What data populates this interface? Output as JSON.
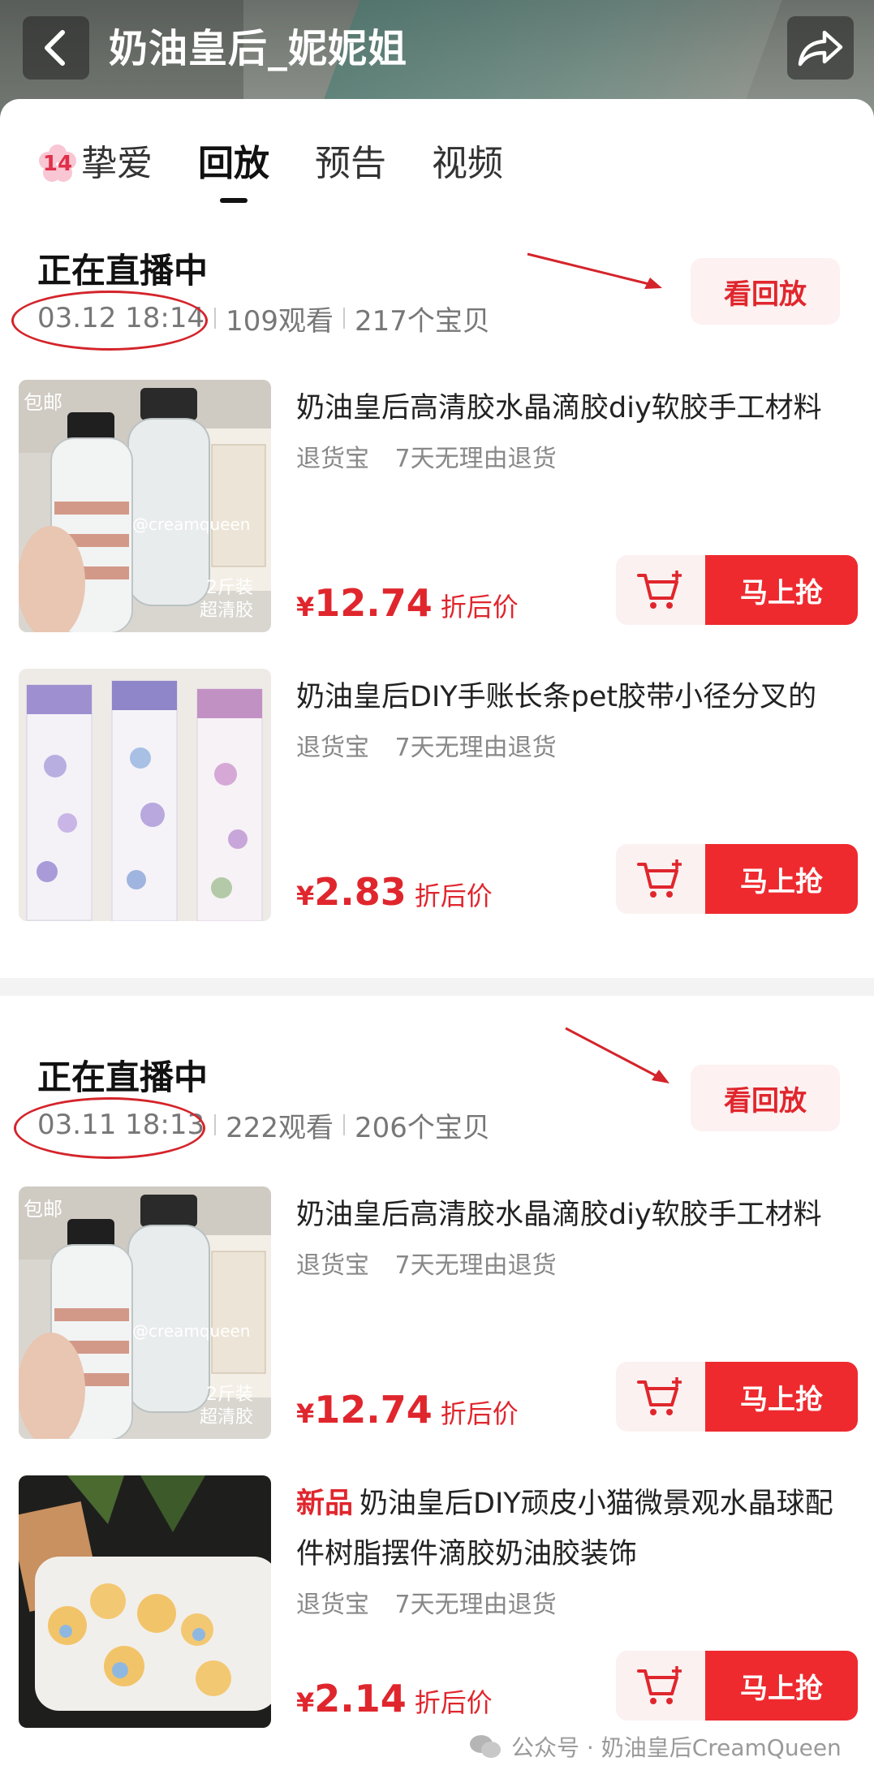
{
  "header": {
    "title": "奶油皇后_妮妮姐",
    "back_icon": "chevron-left-icon",
    "share_icon": "share-arrow-icon"
  },
  "tabs": [
    {
      "badge": "14",
      "label": "挚爱",
      "active": false
    },
    {
      "label": "回放",
      "active": true
    },
    {
      "label": "预告",
      "active": false
    },
    {
      "label": "视频",
      "active": false
    }
  ],
  "sessions": [
    {
      "status": "正在直播中",
      "date": "03.12 18:14",
      "views": "109观看",
      "items_count": "217个宝贝",
      "replay_label": "看回放",
      "products": [
        {
          "thumb_tag": "包邮",
          "thumb_watermark": "@creamqueen",
          "thumb_caption_1": "2斤装",
          "thumb_caption_2": "超清胶",
          "title": "奶油皇后高清胶水晶滴胶diy软胶手工材料",
          "tag_1": "退货宝",
          "tag_2": "7天无理由退货",
          "price_symbol": "¥",
          "price": "12.74",
          "price_label": "折后价",
          "buy_label": "马上抢"
        },
        {
          "title": "奶油皇后DIY手账长条pet胶带小径分叉的",
          "tag_1": "退货宝",
          "tag_2": "7天无理由退货",
          "price_symbol": "¥",
          "price": "2.83",
          "price_label": "折后价",
          "buy_label": "马上抢"
        }
      ]
    },
    {
      "status": "正在直播中",
      "date": "03.11 18:13",
      "views": "222观看",
      "items_count": "206个宝贝",
      "replay_label": "看回放",
      "products": [
        {
          "thumb_tag": "包邮",
          "thumb_watermark": "@creamqueen",
          "thumb_caption_1": "2斤装",
          "thumb_caption_2": "超清胶",
          "title": "奶油皇后高清胶水晶滴胶diy软胶手工材料",
          "tag_1": "退货宝",
          "tag_2": "7天无理由退货",
          "price_symbol": "¥",
          "price": "12.74",
          "price_label": "折后价",
          "buy_label": "马上抢"
        },
        {
          "new_tag": "新品",
          "title": "奶油皇后DIY顽皮小猫微景观水晶球配件树脂摆件滴胶奶油胶装饰",
          "tag_1": "退货宝",
          "tag_2": "7天无理由退货",
          "price_symbol": "¥",
          "price": "2.14",
          "price_label": "折后价",
          "buy_label": "马上抢"
        }
      ]
    }
  ],
  "watermark": "公众号 · 奶油皇后CreamQueen",
  "colors": {
    "accent_red": "#ee2a2f",
    "replay_bg": "#fdf1f1",
    "annotation_red": "#d4242b"
  }
}
